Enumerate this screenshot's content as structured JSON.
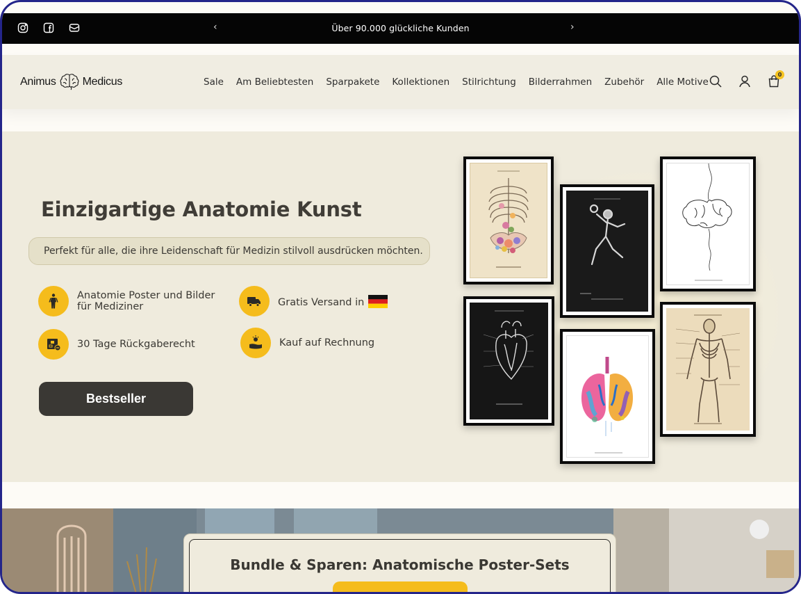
{
  "announcement": {
    "message": "Über 90.000 glückliche Kunden",
    "prev_icon": "chevron-left-icon",
    "next_icon": "chevron-right-icon",
    "prev_glyph": "‹",
    "next_glyph": "›",
    "social": [
      "instagram-icon",
      "facebook-icon",
      "email-icon"
    ]
  },
  "header": {
    "logo_left": "Animus",
    "logo_right": "Medicus",
    "nav": [
      "Sale",
      "Am Beliebtesten",
      "Sparpakete",
      "Kollektionen",
      "Stilrichtung",
      "Bilderrahmen",
      "Zubehör",
      "Alle Motive"
    ],
    "cart_count": "0",
    "icons": [
      "search-icon",
      "account-icon",
      "cart-icon"
    ]
  },
  "hero": {
    "title": "Einzigartige Anatomie Kunst",
    "subtitle": "Perfekt für alle, die ihre Leidenschaft für Medizin stilvoll ausdrücken möchten.",
    "features": [
      {
        "line1": "Anatomie Poster und Bilder",
        "line2": "für Mediziner",
        "icon": "human-body-icon"
      },
      {
        "line1": "Gratis Versand in",
        "icon": "truck-icon",
        "flag": "germany-flag"
      },
      {
        "line1": "30 Tage Rückgaberecht",
        "icon": "return-box-icon"
      },
      {
        "line1": "Kauf auf Rechnung",
        "icon": "hand-coin-icon"
      }
    ],
    "cta": "Bestseller"
  },
  "bundle": {
    "title": "Bundle & Sparen: Anatomische Poster-Sets"
  },
  "colors": {
    "accent": "#f5bc1c",
    "dark": "#3a3834",
    "hero_bg": "#efebdd",
    "frame": "#24258a"
  }
}
